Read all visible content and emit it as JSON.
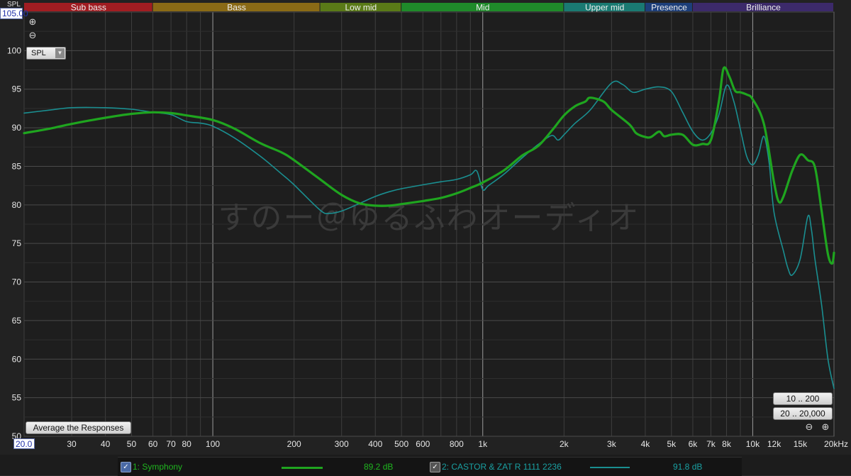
{
  "bands": [
    {
      "label": "Sub bass",
      "from": 20,
      "to": 60,
      "color": "#a11d22"
    },
    {
      "label": "Bass",
      "from": 60,
      "to": 250,
      "color": "#8a6a16"
    },
    {
      "label": "Low mid",
      "from": 250,
      "to": 500,
      "color": "#5a7a17"
    },
    {
      "label": "Mid",
      "from": 500,
      "to": 2000,
      "color": "#1f8a2a"
    },
    {
      "label": "Upper mid",
      "from": 2000,
      "to": 4000,
      "color": "#1a7a72"
    },
    {
      "label": "Presence",
      "from": 4000,
      "to": 6000,
      "color": "#1d3f7a"
    },
    {
      "label": "Brilliance",
      "from": 6000,
      "to": 20000,
      "color": "#3c2a6a"
    }
  ],
  "controls": {
    "y_axis_name": "SPL",
    "y_max_box": "105.00",
    "x_min_box": "20.0",
    "spl_dropdown": "SPL",
    "average_button": "Average the Responses",
    "range_button_1": "10 .. 200",
    "range_button_2": "20 .. 20,000"
  },
  "watermark": "すのー＠ゆるふわオーディオ",
  "legend": {
    "item1_label": "1: Symphony",
    "item1_value": "89.2 dB",
    "item2_label": "2: CASTOR & ZAT R 1111 2236",
    "item2_value": "91.8 dB"
  },
  "chart_data": {
    "type": "line",
    "x_scale": "log",
    "xlim": [
      20,
      20000
    ],
    "ylim": [
      50,
      105
    ],
    "x_ticks": [
      {
        "v": 20,
        "label": "20.0"
      },
      {
        "v": 30,
        "label": "30"
      },
      {
        "v": 40,
        "label": "40"
      },
      {
        "v": 50,
        "label": "50"
      },
      {
        "v": 60,
        "label": "60"
      },
      {
        "v": 70,
        "label": "70"
      },
      {
        "v": 80,
        "label": "80"
      },
      {
        "v": 100,
        "label": "100"
      },
      {
        "v": 200,
        "label": "200"
      },
      {
        "v": 300,
        "label": "300"
      },
      {
        "v": 400,
        "label": "400"
      },
      {
        "v": 500,
        "label": "500"
      },
      {
        "v": 600,
        "label": "600"
      },
      {
        "v": 800,
        "label": "800"
      },
      {
        "v": 1000,
        "label": "1k"
      },
      {
        "v": 2000,
        "label": "2k"
      },
      {
        "v": 3000,
        "label": "3k"
      },
      {
        "v": 4000,
        "label": "4k"
      },
      {
        "v": 5000,
        "label": "5k"
      },
      {
        "v": 6000,
        "label": "6k"
      },
      {
        "v": 7000,
        "label": "7k"
      },
      {
        "v": 8000,
        "label": "8k"
      },
      {
        "v": 10000,
        "label": "10k"
      },
      {
        "v": 12000,
        "label": "12k"
      },
      {
        "v": 15000,
        "label": "15k"
      },
      {
        "v": 20000,
        "label": "20kHz"
      }
    ],
    "y_ticks": [
      100,
      95,
      90,
      85,
      80,
      75,
      70,
      65,
      60,
      55,
      50
    ],
    "series": [
      {
        "name": "1: Symphony",
        "color": "#1fa51f",
        "points": [
          [
            20,
            89.3
          ],
          [
            25,
            89.9
          ],
          [
            30,
            90.5
          ],
          [
            40,
            91.3
          ],
          [
            50,
            91.8
          ],
          [
            60,
            92.0
          ],
          [
            70,
            91.9
          ],
          [
            80,
            91.6
          ],
          [
            100,
            91.0
          ],
          [
            120,
            89.9
          ],
          [
            150,
            88.0
          ],
          [
            180,
            86.8
          ],
          [
            200,
            85.8
          ],
          [
            250,
            83.3
          ],
          [
            300,
            81.3
          ],
          [
            350,
            80.2
          ],
          [
            400,
            79.9
          ],
          [
            450,
            79.9
          ],
          [
            500,
            80.1
          ],
          [
            600,
            80.5
          ],
          [
            700,
            80.9
          ],
          [
            800,
            81.5
          ],
          [
            900,
            82.2
          ],
          [
            1000,
            82.9
          ],
          [
            1200,
            84.5
          ],
          [
            1400,
            86.4
          ],
          [
            1600,
            87.6
          ],
          [
            1800,
            89.6
          ],
          [
            2000,
            91.6
          ],
          [
            2200,
            92.8
          ],
          [
            2400,
            93.4
          ],
          [
            2500,
            93.9
          ],
          [
            2800,
            93.4
          ],
          [
            3000,
            92.3
          ],
          [
            3500,
            90.4
          ],
          [
            3700,
            89.3
          ],
          [
            4000,
            88.8
          ],
          [
            4200,
            88.8
          ],
          [
            4500,
            89.5
          ],
          [
            4700,
            88.9
          ],
          [
            5000,
            89.1
          ],
          [
            5500,
            89.1
          ],
          [
            6000,
            87.8
          ],
          [
            6500,
            87.9
          ],
          [
            7000,
            88.4
          ],
          [
            7500,
            93.5
          ],
          [
            7800,
            97.7
          ],
          [
            8200,
            96.6
          ],
          [
            8600,
            94.8
          ],
          [
            9000,
            94.6
          ],
          [
            9500,
            94.3
          ],
          [
            10000,
            93.7
          ],
          [
            11000,
            90.5
          ],
          [
            12000,
            82.9
          ],
          [
            12500,
            80.4
          ],
          [
            13000,
            81.1
          ],
          [
            14000,
            84.4
          ],
          [
            15000,
            86.5
          ],
          [
            16000,
            85.8
          ],
          [
            17000,
            84.9
          ],
          [
            18000,
            79.2
          ],
          [
            19000,
            73.6
          ],
          [
            19700,
            72.4
          ],
          [
            20000,
            73.8
          ]
        ]
      },
      {
        "name": "2: CASTOR & ZAT R 1111 2236",
        "color": "#1a8f91",
        "points": [
          [
            20,
            91.9
          ],
          [
            25,
            92.3
          ],
          [
            30,
            92.6
          ],
          [
            40,
            92.6
          ],
          [
            50,
            92.4
          ],
          [
            60,
            92.0
          ],
          [
            70,
            91.7
          ],
          [
            80,
            90.8
          ],
          [
            90,
            90.6
          ],
          [
            100,
            90.2
          ],
          [
            120,
            88.7
          ],
          [
            150,
            86.3
          ],
          [
            180,
            84.0
          ],
          [
            200,
            82.6
          ],
          [
            250,
            79.3
          ],
          [
            270,
            78.9
          ],
          [
            300,
            79.2
          ],
          [
            350,
            80.2
          ],
          [
            400,
            81.1
          ],
          [
            450,
            81.7
          ],
          [
            500,
            82.1
          ],
          [
            600,
            82.6
          ],
          [
            700,
            83.0
          ],
          [
            800,
            83.3
          ],
          [
            900,
            83.9
          ],
          [
            950,
            84.4
          ],
          [
            1000,
            82.0
          ],
          [
            1050,
            82.5
          ],
          [
            1200,
            84.0
          ],
          [
            1400,
            86.1
          ],
          [
            1600,
            87.8
          ],
          [
            1800,
            89.0
          ],
          [
            1900,
            88.4
          ],
          [
            2000,
            89.1
          ],
          [
            2200,
            90.6
          ],
          [
            2500,
            92.3
          ],
          [
            3000,
            95.8
          ],
          [
            3300,
            95.6
          ],
          [
            3600,
            94.6
          ],
          [
            4000,
            95.0
          ],
          [
            4500,
            95.3
          ],
          [
            5000,
            94.7
          ],
          [
            5500,
            92.0
          ],
          [
            6000,
            89.5
          ],
          [
            6500,
            88.4
          ],
          [
            7000,
            89.3
          ],
          [
            7500,
            91.7
          ],
          [
            8000,
            95.5
          ],
          [
            8500,
            93.5
          ],
          [
            9000,
            89.8
          ],
          [
            9500,
            86.3
          ],
          [
            10000,
            85.2
          ],
          [
            10500,
            86.5
          ],
          [
            11000,
            88.9
          ],
          [
            11500,
            85.5
          ],
          [
            12000,
            79.0
          ],
          [
            13000,
            74.0
          ],
          [
            13500,
            71.8
          ],
          [
            14000,
            70.9
          ],
          [
            15000,
            73.0
          ],
          [
            16000,
            78.5
          ],
          [
            16500,
            76.8
          ],
          [
            17000,
            73.0
          ],
          [
            18000,
            67.0
          ],
          [
            19000,
            60.0
          ],
          [
            20000,
            56.2
          ]
        ]
      }
    ]
  }
}
